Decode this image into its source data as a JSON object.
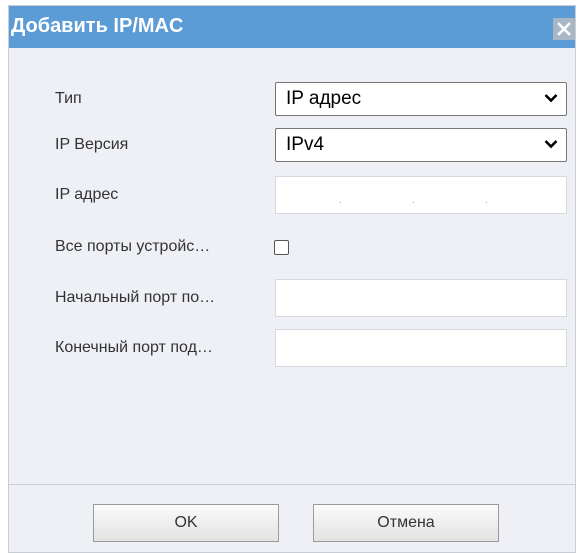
{
  "dialog": {
    "title": "Добавить IP/MAC",
    "title_bar_color": "#5b9bd6",
    "close_icon": "close-icon"
  },
  "form": {
    "type": {
      "label": "Тип",
      "value": "IP адрес"
    },
    "ip_version": {
      "label": "IP Версия",
      "value": "IPv4"
    },
    "ip_address": {
      "label": "IP адрес",
      "value": "",
      "separators": [
        ".",
        ".",
        "."
      ]
    },
    "all_ports": {
      "label": "Все порты устройс…",
      "checked": false
    },
    "start_port": {
      "label": "Начальный порт по…",
      "value": ""
    },
    "end_port": {
      "label": "Конечный порт под…",
      "value": ""
    }
  },
  "buttons": {
    "ok_label": "OK",
    "cancel_label": "Отмена"
  }
}
